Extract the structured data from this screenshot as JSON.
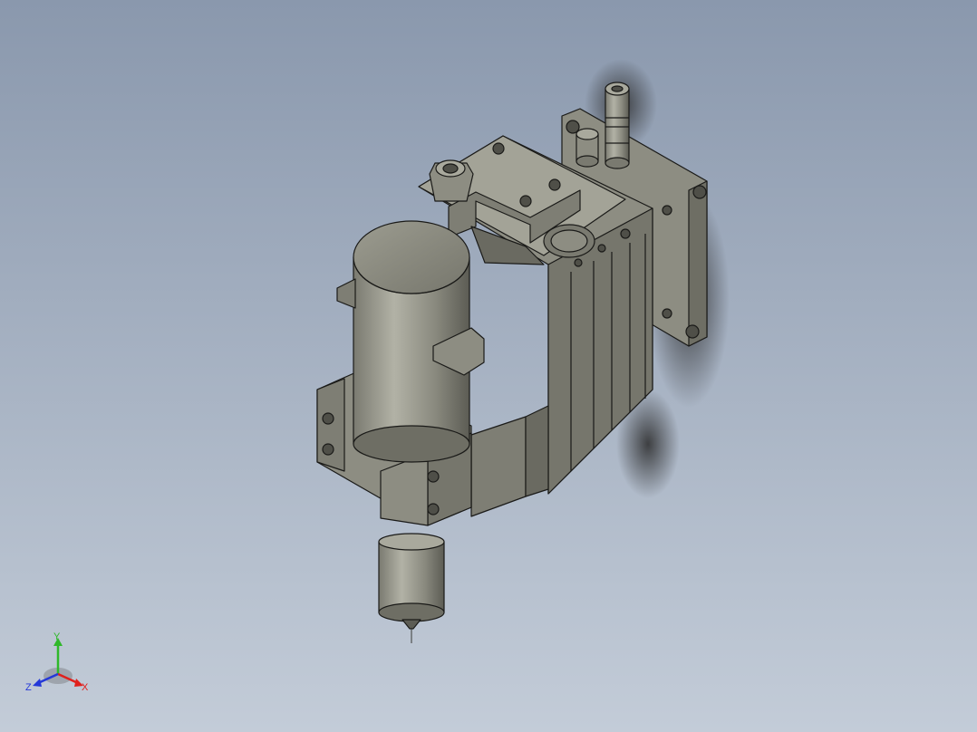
{
  "viewport": {
    "background_top": "#8a98ad",
    "background_bottom": "#c3ccd8"
  },
  "model": {
    "body_color": "#8d8d82",
    "shade_color": "#6e6e64",
    "light_color": "#a9a99d",
    "edge_color": "#1a1a18"
  },
  "triad": {
    "x_label": "X",
    "y_label": "Y",
    "z_label": "Z",
    "x_color": "#e0201c",
    "y_color": "#2fb82a",
    "z_color": "#2438d8"
  }
}
